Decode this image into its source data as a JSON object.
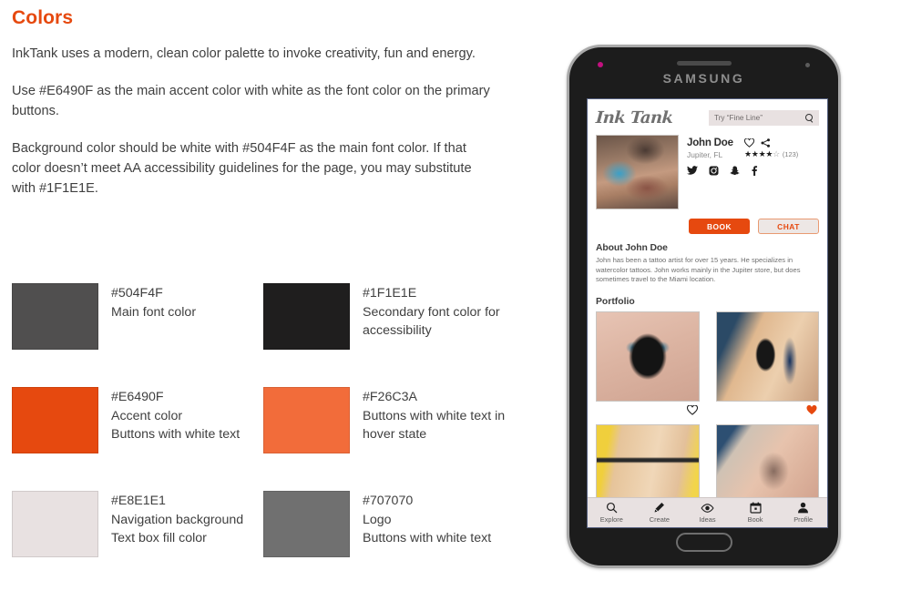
{
  "spec": {
    "title": "Colors",
    "paragraphs": [
      "InkTank uses a modern, clean color palette to invoke creativity, fun and energy.",
      "Use #E6490F as the main accent color with white as the font color on the primary buttons.",
      "Background color should be white with #504F4F as the main font color. If that color doesn’t meet AA accessibility guidelines for the page, you may substitute with #1F1E1E."
    ],
    "swatches": [
      {
        "hex": "#504F4F",
        "color": "#504F4F",
        "note": "Main font color"
      },
      {
        "hex": "#1F1E1E",
        "color": "#1F1E1E",
        "note": "Secondary font color for accessibility"
      },
      {
        "hex": "#E6490F",
        "color": "#E6490F",
        "note": "Accent color\nButtons with white text"
      },
      {
        "hex": "#F26C3A",
        "color": "#F26C3A",
        "note": "Buttons with white text in hover state"
      },
      {
        "hex": "#E8E1E1",
        "color": "#E8E1E1",
        "note": "Navigation background\nText box fill color"
      },
      {
        "hex": "#707070",
        "color": "#707070",
        "note": "Logo\nButtons with white text"
      }
    ]
  },
  "phone": {
    "brand": "SAMSUNG",
    "led_color": "#C2107F"
  },
  "app": {
    "logo_text": "Ink Tank",
    "search": {
      "placeholder": "Try “Fine Line”",
      "icon": "search-icon"
    },
    "profile": {
      "name": "John Doe",
      "location": "Jupiter, FL",
      "rating_filled": 4,
      "rating_total": 5,
      "rating_count": "(123)",
      "favorite_icon": "heart-outline-icon",
      "share_icon": "share-icon",
      "social": [
        "twitter-icon",
        "instagram-icon",
        "snapchat-icon",
        "facebook-icon"
      ]
    },
    "buttons": {
      "book": "BOOK",
      "chat": "CHAT"
    },
    "about": {
      "title": "About John Doe",
      "body": "John has been a tattoo artist for over 15 years. He specializes in watercolor tattoos. John works mainly in the Jupiter store, but does sometimes travel to the Miami location."
    },
    "portfolio": {
      "title": "Portfolio",
      "items": [
        {
          "name": "wolf-tattoo",
          "liked": false
        },
        {
          "name": "panther-tattoo",
          "liked": true
        },
        {
          "name": "neck-tattoo",
          "liked": false
        },
        {
          "name": "face-tattoo",
          "liked": false
        }
      ]
    },
    "nav": [
      {
        "label": "Explore",
        "icon": "search-icon"
      },
      {
        "label": "Create",
        "icon": "pencil-icon"
      },
      {
        "label": "Ideas",
        "icon": "eye-icon"
      },
      {
        "label": "Book",
        "icon": "calendar-icon"
      },
      {
        "label": "Profile",
        "icon": "person-icon"
      }
    ]
  }
}
